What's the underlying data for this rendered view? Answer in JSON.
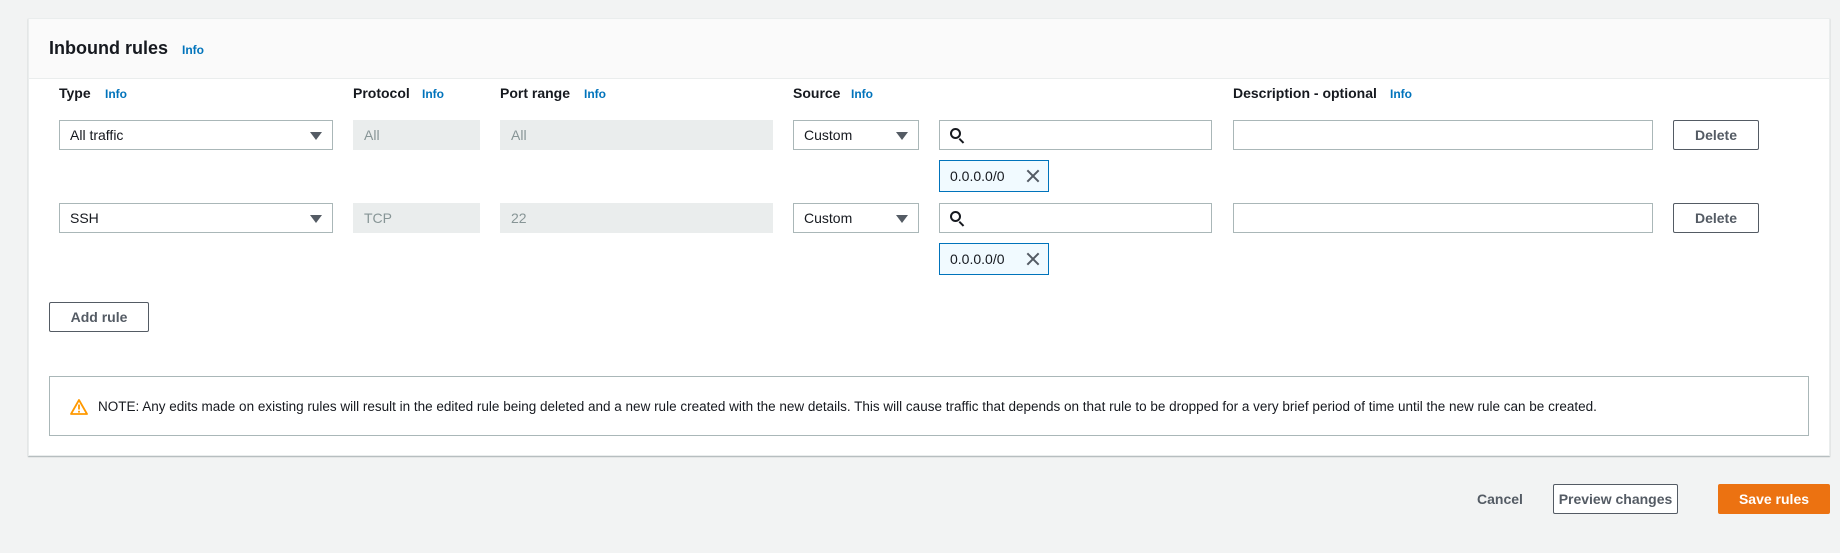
{
  "section": {
    "title": "Inbound rules",
    "title_info": "Info"
  },
  "columns": {
    "type": "Type",
    "protocol": "Protocol",
    "port_range": "Port range",
    "source": "Source",
    "description": "Description - optional",
    "info": "Info"
  },
  "rules": [
    {
      "type": "All traffic",
      "protocol": "All",
      "port_range": "All",
      "source_type": "Custom",
      "source_search": "",
      "source_token": "0.0.0.0/0",
      "description": "",
      "delete_label": "Delete"
    },
    {
      "type": "SSH",
      "protocol": "TCP",
      "port_range": "22",
      "source_type": "Custom",
      "source_search": "",
      "source_token": "0.0.0.0/0",
      "description": "",
      "delete_label": "Delete"
    }
  ],
  "add_rule_label": "Add rule",
  "alert": {
    "icon": "warning-icon",
    "text": "NOTE: Any edits made on existing rules will result in the edited rule being deleted and a new rule created with the new details. This will cause traffic that depends on that rule to be dropped for a very brief period of time until the new rule can be created."
  },
  "footer": {
    "cancel_label": "Cancel",
    "preview_label": "Preview changes",
    "save_label": "Save rules"
  },
  "colors": {
    "link": "#0073bb",
    "primary": "#ec7211",
    "warning": "#ff9900"
  }
}
